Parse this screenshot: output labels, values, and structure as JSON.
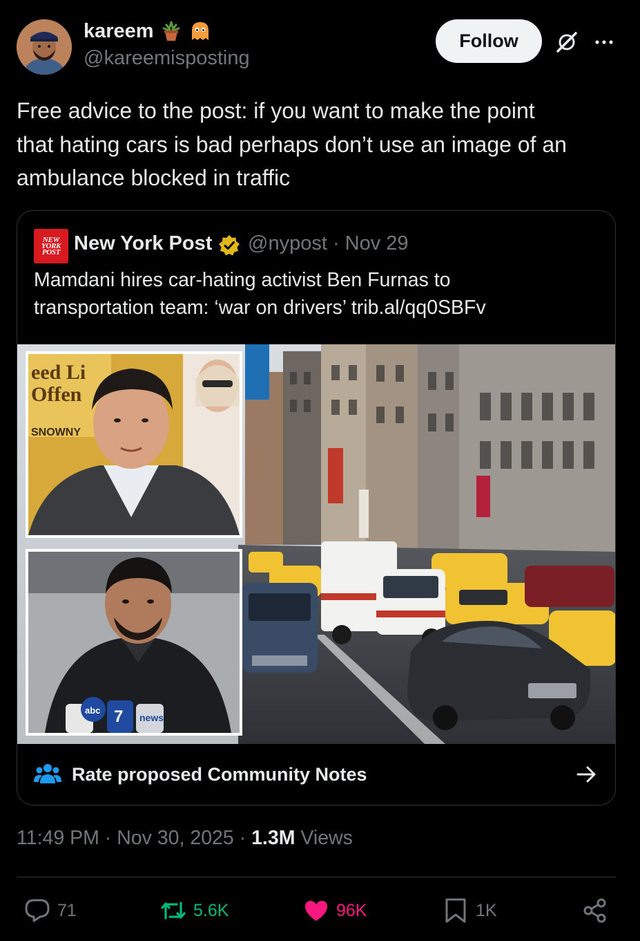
{
  "author": {
    "display_name": "kareem",
    "handle": "@kareemisposting",
    "badges": [
      "potted-plant-emoji",
      "ghost-emoji"
    ]
  },
  "header": {
    "follow_label": "Follow",
    "icons": [
      "grok-icon",
      "more-icon"
    ]
  },
  "post": {
    "text": "Free advice to the post: if you want to make the point\nthat hating cars is bad perhaps don’t use an image of an\nambulance blocked in traffic"
  },
  "quote": {
    "logo_text": "NEW YORK POST",
    "name": "New York Post",
    "handle_date": "@nypost · Nov 29",
    "text": "Mamdani hires car-hating activist Ben Furnas to\ntransportation team: ‘war on drivers’ trib.al/qq0SBFv",
    "community_notes_label": "Rate proposed Community Notes"
  },
  "meta": {
    "time_date": "11:49 PM · Nov 30, 2025 · ",
    "views_count": "1.3M",
    "views_label": " Views"
  },
  "actions": {
    "replies": "71",
    "reposts": "5.6K",
    "likes": "96K",
    "bookmarks": "1K"
  },
  "colors": {
    "background": "#000000",
    "text": "#e7e9ea",
    "muted": "#71767b",
    "repost": "#00ba7c",
    "like": "#f91880",
    "community_notes": "#1d9bf0",
    "verified": "#e2b719"
  }
}
